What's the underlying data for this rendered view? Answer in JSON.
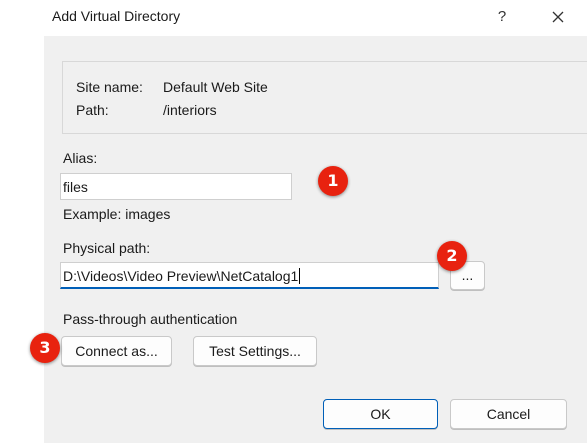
{
  "window": {
    "title": "Add Virtual Directory",
    "help_label": "?",
    "close_icon": "close-icon"
  },
  "site_info": {
    "site_name_label": "Site name:",
    "site_name_value": "Default Web Site",
    "path_label": "Path:",
    "path_value": "/interiors"
  },
  "alias": {
    "label": "Alias:",
    "value": "files",
    "example": "Example: images"
  },
  "physical_path": {
    "label": "Physical path:",
    "value": "D:\\Videos\\Video Preview\\NetCatalog1",
    "browse_label": "..."
  },
  "auth": {
    "label": "Pass-through authentication",
    "connect_as_label": "Connect as...",
    "test_settings_label": "Test Settings..."
  },
  "footer": {
    "ok_label": "OK",
    "cancel_label": "Cancel"
  },
  "annotations": {
    "badge_1": "1",
    "badge_2": "2",
    "badge_3": "3",
    "badge_color": "#e8220f"
  },
  "colors": {
    "dialog_bg": "#f0f0f0",
    "accent": "#005fb8"
  }
}
